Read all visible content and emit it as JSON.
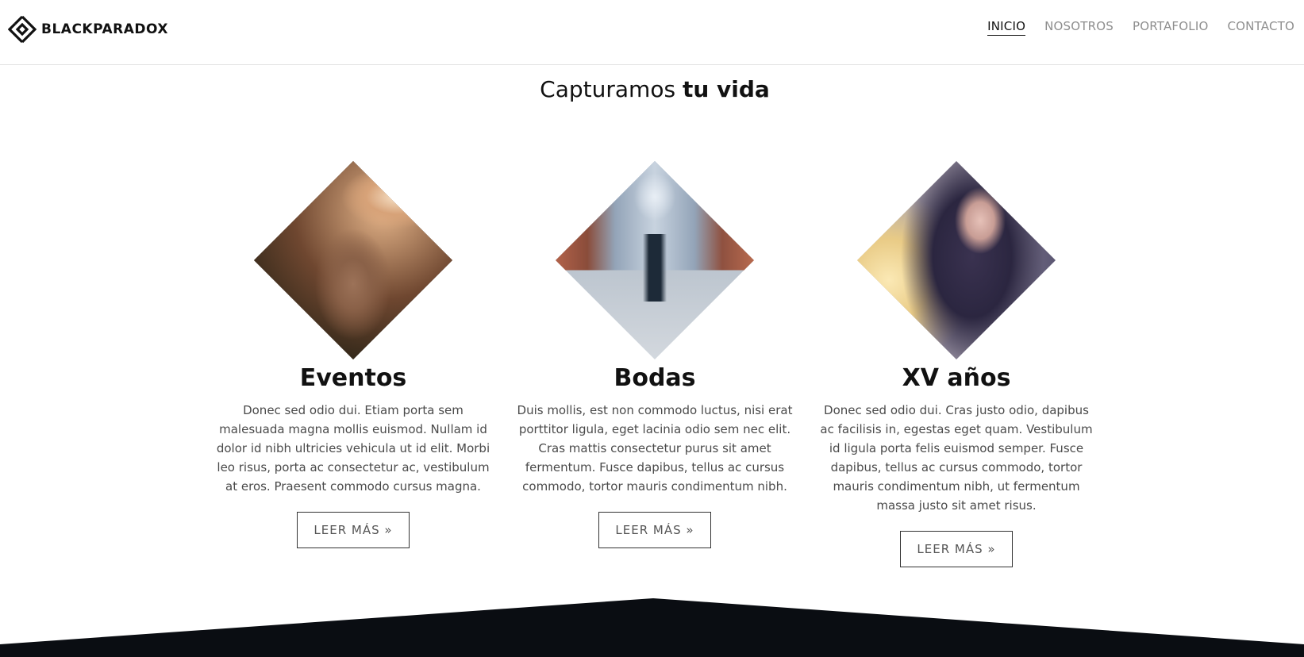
{
  "brand": {
    "name": "BLACKPARADOX",
    "logo_icon": "diamond-logo-icon"
  },
  "nav": {
    "items": [
      {
        "label": "INICIO",
        "active": true
      },
      {
        "label": "NOSOTROS",
        "active": false
      },
      {
        "label": "PORTAFOLIO",
        "active": false
      },
      {
        "label": "CONTACTO",
        "active": false
      }
    ]
  },
  "heading": {
    "normal": "Capturamos ",
    "bold": "tu vida"
  },
  "cards": [
    {
      "title": "Eventos",
      "image": "dog-photo",
      "text": "Donec sed odio dui. Etiam porta sem malesuada magna mollis euismod. Nullam id dolor id nibh ultricies vehicula ut id elit. Morbi leo risus, porta ac consectetur ac, vestibulum at eros. Praesent commodo cursus magna.",
      "button": "LEER MÁS »"
    },
    {
      "title": "Bodas",
      "image": "city-street-photo",
      "text": "Duis mollis, est non commodo luctus, nisi erat porttitor ligula, eget lacinia odio sem nec elit. Cras mattis consectetur purus sit amet fermentum. Fusce dapibus, tellus ac cursus commodo, tortor mauris condimentum nibh.",
      "button": "LEER MÁS »"
    },
    {
      "title": "XV años",
      "image": "portrait-photo",
      "text": "Donec sed odio dui. Cras justo odio, dapibus ac facilisis in, egestas eget quam. Vestibulum id ligula porta felis euismod semper. Fusce dapibus, tellus ac cursus commodo, tortor mauris condimentum nibh, ut fermentum massa justo sit amet risus.",
      "button": "LEER MÁS »"
    }
  ],
  "colors": {
    "dark_band": "#0a0d12",
    "nav_active": "#111111",
    "nav_inactive": "#8e8e8e"
  }
}
